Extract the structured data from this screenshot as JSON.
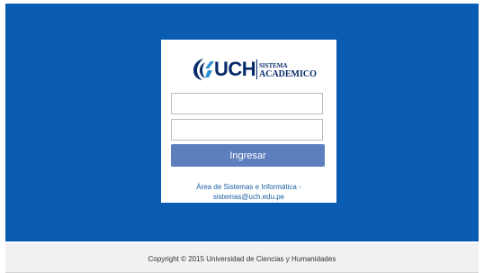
{
  "brand": {
    "name": "UCH",
    "system_line1": "SISTEMA",
    "system_line2": "ACADEMICO"
  },
  "login": {
    "username_value": "",
    "password_value": "",
    "submit_label": "Ingresar"
  },
  "support": {
    "line1": "Área de Sistemas e Informática -",
    "line2": "sistemas@uch.edu.pe"
  },
  "footer": {
    "copyright": "Copyright © 2015 Universidad de Ciencias y Humanidades"
  },
  "colors": {
    "background": "#0a5bb2",
    "button": "#5d7fbe",
    "logo": "#062a6a",
    "link": "#1b5fa5"
  }
}
